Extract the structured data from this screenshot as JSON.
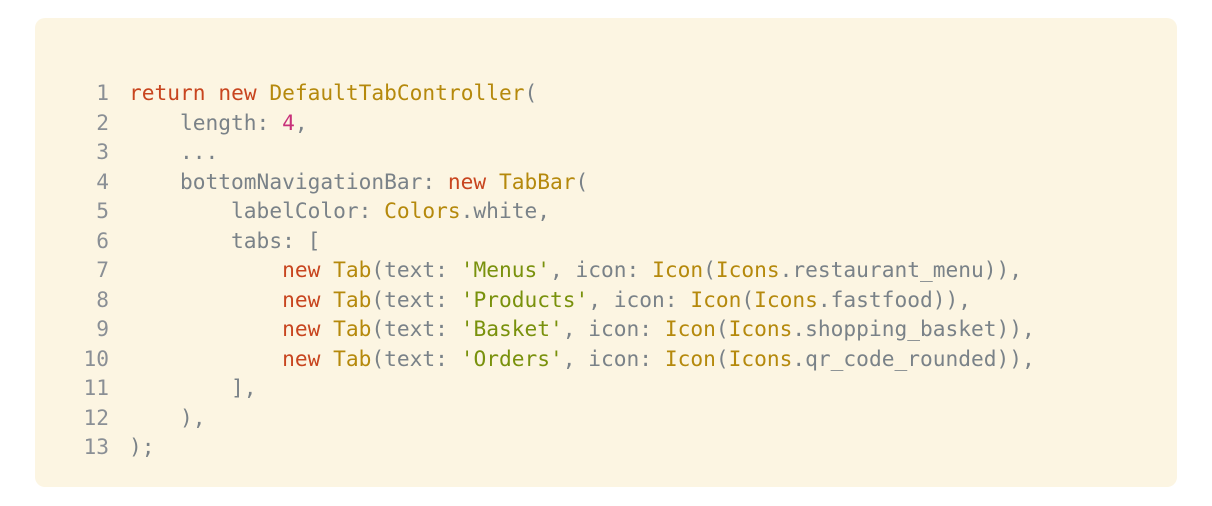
{
  "colors": {
    "background": "#fcf5e2",
    "keyword": "#c8451f",
    "type": "#b5890c",
    "string": "#79910c",
    "number": "#c8317a",
    "plain": "#7a8288",
    "line_number": "#8a8f95"
  },
  "code": {
    "language": "dart",
    "lines": [
      {
        "n": "1",
        "tokens": [
          {
            "t": "kw",
            "v": "return"
          },
          {
            "t": "plain",
            "v": " "
          },
          {
            "t": "kw",
            "v": "new"
          },
          {
            "t": "plain",
            "v": " "
          },
          {
            "t": "type",
            "v": "DefaultTabController"
          },
          {
            "t": "plain",
            "v": "("
          }
        ]
      },
      {
        "n": "2",
        "tokens": [
          {
            "t": "plain",
            "v": "    length: "
          },
          {
            "t": "num",
            "v": "4"
          },
          {
            "t": "plain",
            "v": ","
          }
        ]
      },
      {
        "n": "3",
        "tokens": [
          {
            "t": "plain",
            "v": "    ..."
          }
        ]
      },
      {
        "n": "4",
        "tokens": [
          {
            "t": "plain",
            "v": "    bottomNavigationBar: "
          },
          {
            "t": "kw",
            "v": "new"
          },
          {
            "t": "plain",
            "v": " "
          },
          {
            "t": "type",
            "v": "TabBar"
          },
          {
            "t": "plain",
            "v": "("
          }
        ]
      },
      {
        "n": "5",
        "tokens": [
          {
            "t": "plain",
            "v": "        labelColor: "
          },
          {
            "t": "type",
            "v": "Colors"
          },
          {
            "t": "plain",
            "v": ".white,"
          }
        ]
      },
      {
        "n": "6",
        "tokens": [
          {
            "t": "plain",
            "v": "        tabs: ["
          }
        ]
      },
      {
        "n": "7",
        "tokens": [
          {
            "t": "plain",
            "v": "            "
          },
          {
            "t": "kw",
            "v": "new"
          },
          {
            "t": "plain",
            "v": " "
          },
          {
            "t": "type",
            "v": "Tab"
          },
          {
            "t": "plain",
            "v": "(text: "
          },
          {
            "t": "str",
            "v": "'Menus'"
          },
          {
            "t": "plain",
            "v": ", icon: "
          },
          {
            "t": "type",
            "v": "Icon"
          },
          {
            "t": "plain",
            "v": "("
          },
          {
            "t": "type",
            "v": "Icons"
          },
          {
            "t": "plain",
            "v": ".restaurant_menu)),"
          }
        ]
      },
      {
        "n": "8",
        "tokens": [
          {
            "t": "plain",
            "v": "            "
          },
          {
            "t": "kw",
            "v": "new"
          },
          {
            "t": "plain",
            "v": " "
          },
          {
            "t": "type",
            "v": "Tab"
          },
          {
            "t": "plain",
            "v": "(text: "
          },
          {
            "t": "str",
            "v": "'Products'"
          },
          {
            "t": "plain",
            "v": ", icon: "
          },
          {
            "t": "type",
            "v": "Icon"
          },
          {
            "t": "plain",
            "v": "("
          },
          {
            "t": "type",
            "v": "Icons"
          },
          {
            "t": "plain",
            "v": ".fastfood)),"
          }
        ]
      },
      {
        "n": "9",
        "tokens": [
          {
            "t": "plain",
            "v": "            "
          },
          {
            "t": "kw",
            "v": "new"
          },
          {
            "t": "plain",
            "v": " "
          },
          {
            "t": "type",
            "v": "Tab"
          },
          {
            "t": "plain",
            "v": "(text: "
          },
          {
            "t": "str",
            "v": "'Basket'"
          },
          {
            "t": "plain",
            "v": ", icon: "
          },
          {
            "t": "type",
            "v": "Icon"
          },
          {
            "t": "plain",
            "v": "("
          },
          {
            "t": "type",
            "v": "Icons"
          },
          {
            "t": "plain",
            "v": ".shopping_basket)),"
          }
        ]
      },
      {
        "n": "10",
        "tokens": [
          {
            "t": "plain",
            "v": "            "
          },
          {
            "t": "kw",
            "v": "new"
          },
          {
            "t": "plain",
            "v": " "
          },
          {
            "t": "type",
            "v": "Tab"
          },
          {
            "t": "plain",
            "v": "(text: "
          },
          {
            "t": "str",
            "v": "'Orders'"
          },
          {
            "t": "plain",
            "v": ", icon: "
          },
          {
            "t": "type",
            "v": "Icon"
          },
          {
            "t": "plain",
            "v": "("
          },
          {
            "t": "type",
            "v": "Icons"
          },
          {
            "t": "plain",
            "v": ".qr_code_rounded)),"
          }
        ]
      },
      {
        "n": "11",
        "tokens": [
          {
            "t": "plain",
            "v": "        ],"
          }
        ]
      },
      {
        "n": "12",
        "tokens": [
          {
            "t": "plain",
            "v": "    ),"
          }
        ]
      },
      {
        "n": "13",
        "tokens": [
          {
            "t": "plain",
            "v": ");"
          }
        ]
      }
    ]
  }
}
